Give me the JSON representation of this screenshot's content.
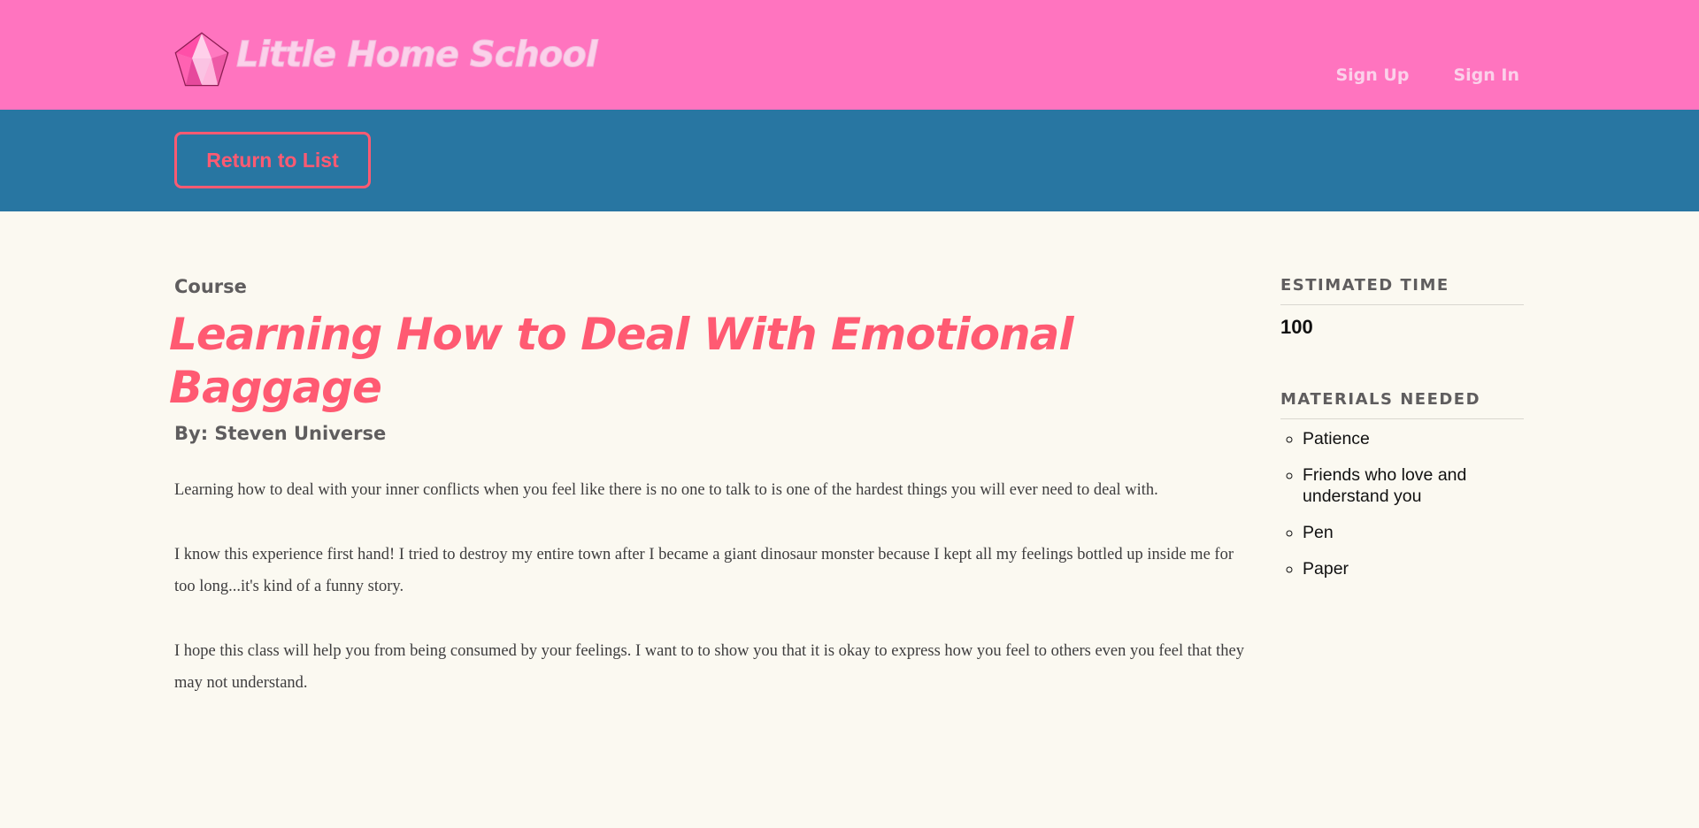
{
  "header": {
    "logo_text": "Little Home School",
    "nav": {
      "sign_up": "Sign Up",
      "sign_in": "Sign In"
    }
  },
  "subbar": {
    "return_label": "Return to List"
  },
  "course": {
    "label": "Course",
    "title": "Learning How to Deal With Emotional Baggage",
    "author": "By: Steven Universe",
    "paragraphs": [
      "Learning how to deal with your inner conflicts when you feel like there is no one to talk to is one of the hardest things you will ever need to deal with.",
      "I know this experience first hand! I tried to destroy my entire town after I became a giant dinosaur monster because I kept all my feelings bottled up inside me for too long...it's kind of a funny story.",
      "I hope this class will help you from being consumed by your feelings. I want to to show you that it is okay to express how you feel to others even you feel that they may not understand."
    ]
  },
  "sidebar": {
    "time_heading": "ESTIMATED TIME",
    "time_value": "100",
    "materials_heading": "MATERIALS NEEDED",
    "materials": [
      "Patience",
      "Friends who love and understand you",
      "Pen",
      "Paper"
    ]
  },
  "colors": {
    "header_bg": "#ff74bf",
    "subbar_bg": "#2876a2",
    "accent": "#ff5a72",
    "page_bg": "#fbf9f1"
  },
  "icons": {
    "logo": "pink-gem-icon"
  }
}
